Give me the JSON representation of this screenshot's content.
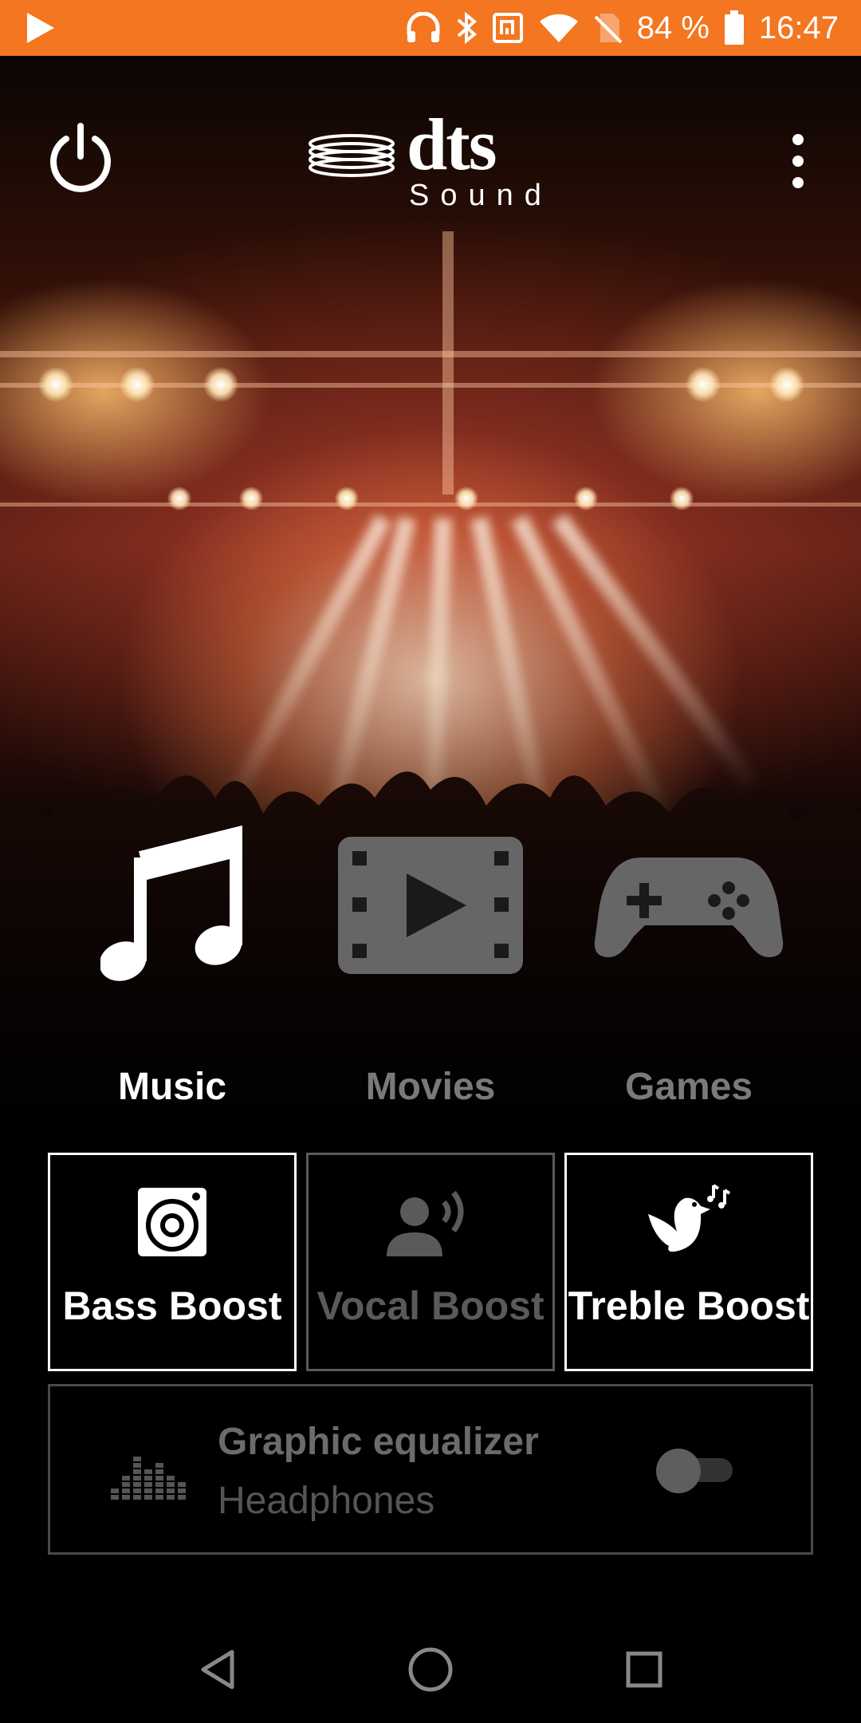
{
  "status_bar": {
    "battery": "84 %",
    "time": "16:47",
    "icons": [
      "play-icon",
      "headphones-icon",
      "bluetooth-icon",
      "nfc-icon",
      "wifi-icon",
      "no-sim-icon",
      "battery-icon"
    ]
  },
  "header": {
    "logo_word": "dts",
    "logo_sub": "Sound",
    "power_icon": "power-icon",
    "menu_icon": "more-vertical-icon"
  },
  "modes": [
    {
      "label": "Music",
      "icon": "music-note-icon",
      "active": true
    },
    {
      "label": "Movies",
      "icon": "film-play-icon",
      "active": false
    },
    {
      "label": "Games",
      "icon": "gamepad-icon",
      "active": false
    }
  ],
  "boosts": [
    {
      "label": "Bass Boost",
      "icon": "speaker-icon",
      "enabled": true
    },
    {
      "label": "Vocal Boost",
      "icon": "voice-icon",
      "enabled": false
    },
    {
      "label": "Treble Boost",
      "icon": "bird-icon",
      "enabled": true
    }
  ],
  "equalizer": {
    "title": "Graphic equalizer",
    "subtitle": "Headphones",
    "icon": "equalizer-icon",
    "toggle_on": false
  },
  "nav": {
    "back": "back-icon",
    "home": "home-icon",
    "recents": "recents-icon"
  },
  "colors": {
    "status_bar": "#f47621",
    "active": "#ffffff",
    "inactive": "#6b6b6b"
  }
}
